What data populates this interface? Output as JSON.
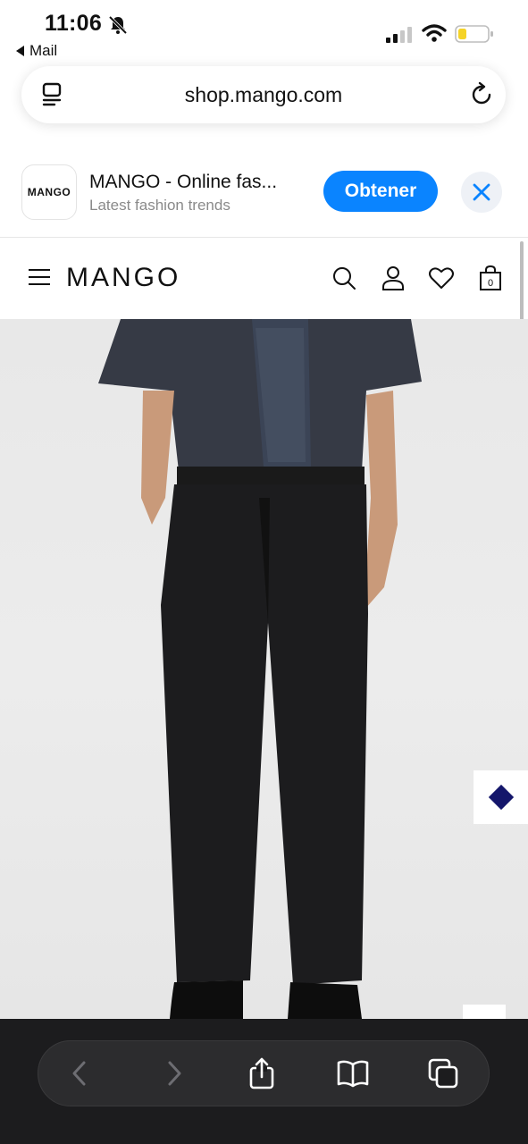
{
  "status_bar": {
    "time": "11:06",
    "back_app": "Mail",
    "icons": [
      "bell-slash-icon",
      "signal-icon",
      "wifi-icon",
      "battery-icon"
    ]
  },
  "address_bar": {
    "url": "shop.mango.com",
    "icons": [
      "reader-mode-icon",
      "reload-icon"
    ]
  },
  "app_banner": {
    "app_icon_text": "MANGO",
    "title": "MANGO - Online fas...",
    "subtitle": "Latest fashion trends",
    "get_button": "Obtener",
    "icons": [
      "close-icon"
    ],
    "colors": {
      "button": "#0a84ff",
      "close_bg": "#eef1f6"
    }
  },
  "site_header": {
    "logo": "MANGO",
    "bag_count": "0",
    "icons": [
      "menu-icon",
      "search-icon",
      "account-icon",
      "heart-icon",
      "bag-icon"
    ]
  },
  "product": {
    "image_description_icon": "product-photo",
    "floating_icon": "diamond-icon",
    "colors": {
      "diamond": "#14166b"
    }
  },
  "bottom_toolbar": {
    "icons": [
      "back-icon",
      "forward-icon",
      "share-icon",
      "bookmarks-icon",
      "tabs-icon"
    ]
  }
}
